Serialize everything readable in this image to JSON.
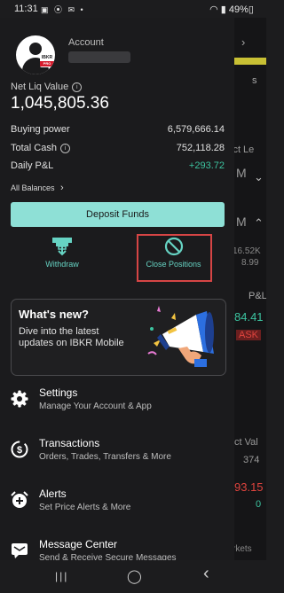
{
  "status_bar": {
    "time": "11:31",
    "icons": "▣ ⦿ ✉ •",
    "right": "◠ ▮ 49%▯"
  },
  "account": {
    "label": "Account",
    "brand_top": "IBKR",
    "brand_bottom": "PRO"
  },
  "net_liq": {
    "label": "Net Liq Value",
    "value": "1,045,805.36"
  },
  "metrics": [
    {
      "label": "Buying power",
      "value": "6,579,666.14",
      "info": false
    },
    {
      "label": "Total Cash",
      "value": "752,118.28",
      "info": true
    },
    {
      "label": "Daily P&L",
      "value": "+293.72",
      "info": false
    }
  ],
  "all_balances": {
    "label": "All Balances",
    "chevron": "›"
  },
  "deposit": {
    "label": "Deposit Funds"
  },
  "actions": {
    "withdraw": "Withdraw",
    "close_positions": "Close Positions"
  },
  "whats_new": {
    "title": "What's new?",
    "body": "Dive into the latest updates on IBKR Mobile"
  },
  "menu": [
    {
      "title": "Settings",
      "subtitle": "Manage Your Account & App",
      "icon": "gear-icon"
    },
    {
      "title": "Transactions",
      "subtitle": "Orders, Trades, Transfers & More",
      "icon": "dollar-clock-icon"
    },
    {
      "title": "Alerts",
      "subtitle": "Set Price Alerts & More",
      "icon": "alarm-icon"
    },
    {
      "title": "Message Center",
      "subtitle": "Send & Receive Secure Messages",
      "icon": "message-icon"
    }
  ],
  "background_peek": {
    "texts": [
      "s",
      "ict Le",
      "M",
      "M",
      "16.52K",
      "8.99",
      "P&L",
      "84.41",
      "ASK",
      "ct Val",
      "374",
      "93.15",
      "0",
      "rkets"
    ],
    "chevrons": [
      "›",
      "⌄",
      "⌃"
    ]
  },
  "nav_bar": {
    "recents": "|||",
    "home": "◯",
    "back": "‹"
  },
  "colors": {
    "accent": "#8ee0d6",
    "teal_text": "#66d3c3",
    "profit": "#3cc4a0",
    "loss": "#e0443e",
    "highlight": "#d64545",
    "yellow": "#c8c034"
  }
}
